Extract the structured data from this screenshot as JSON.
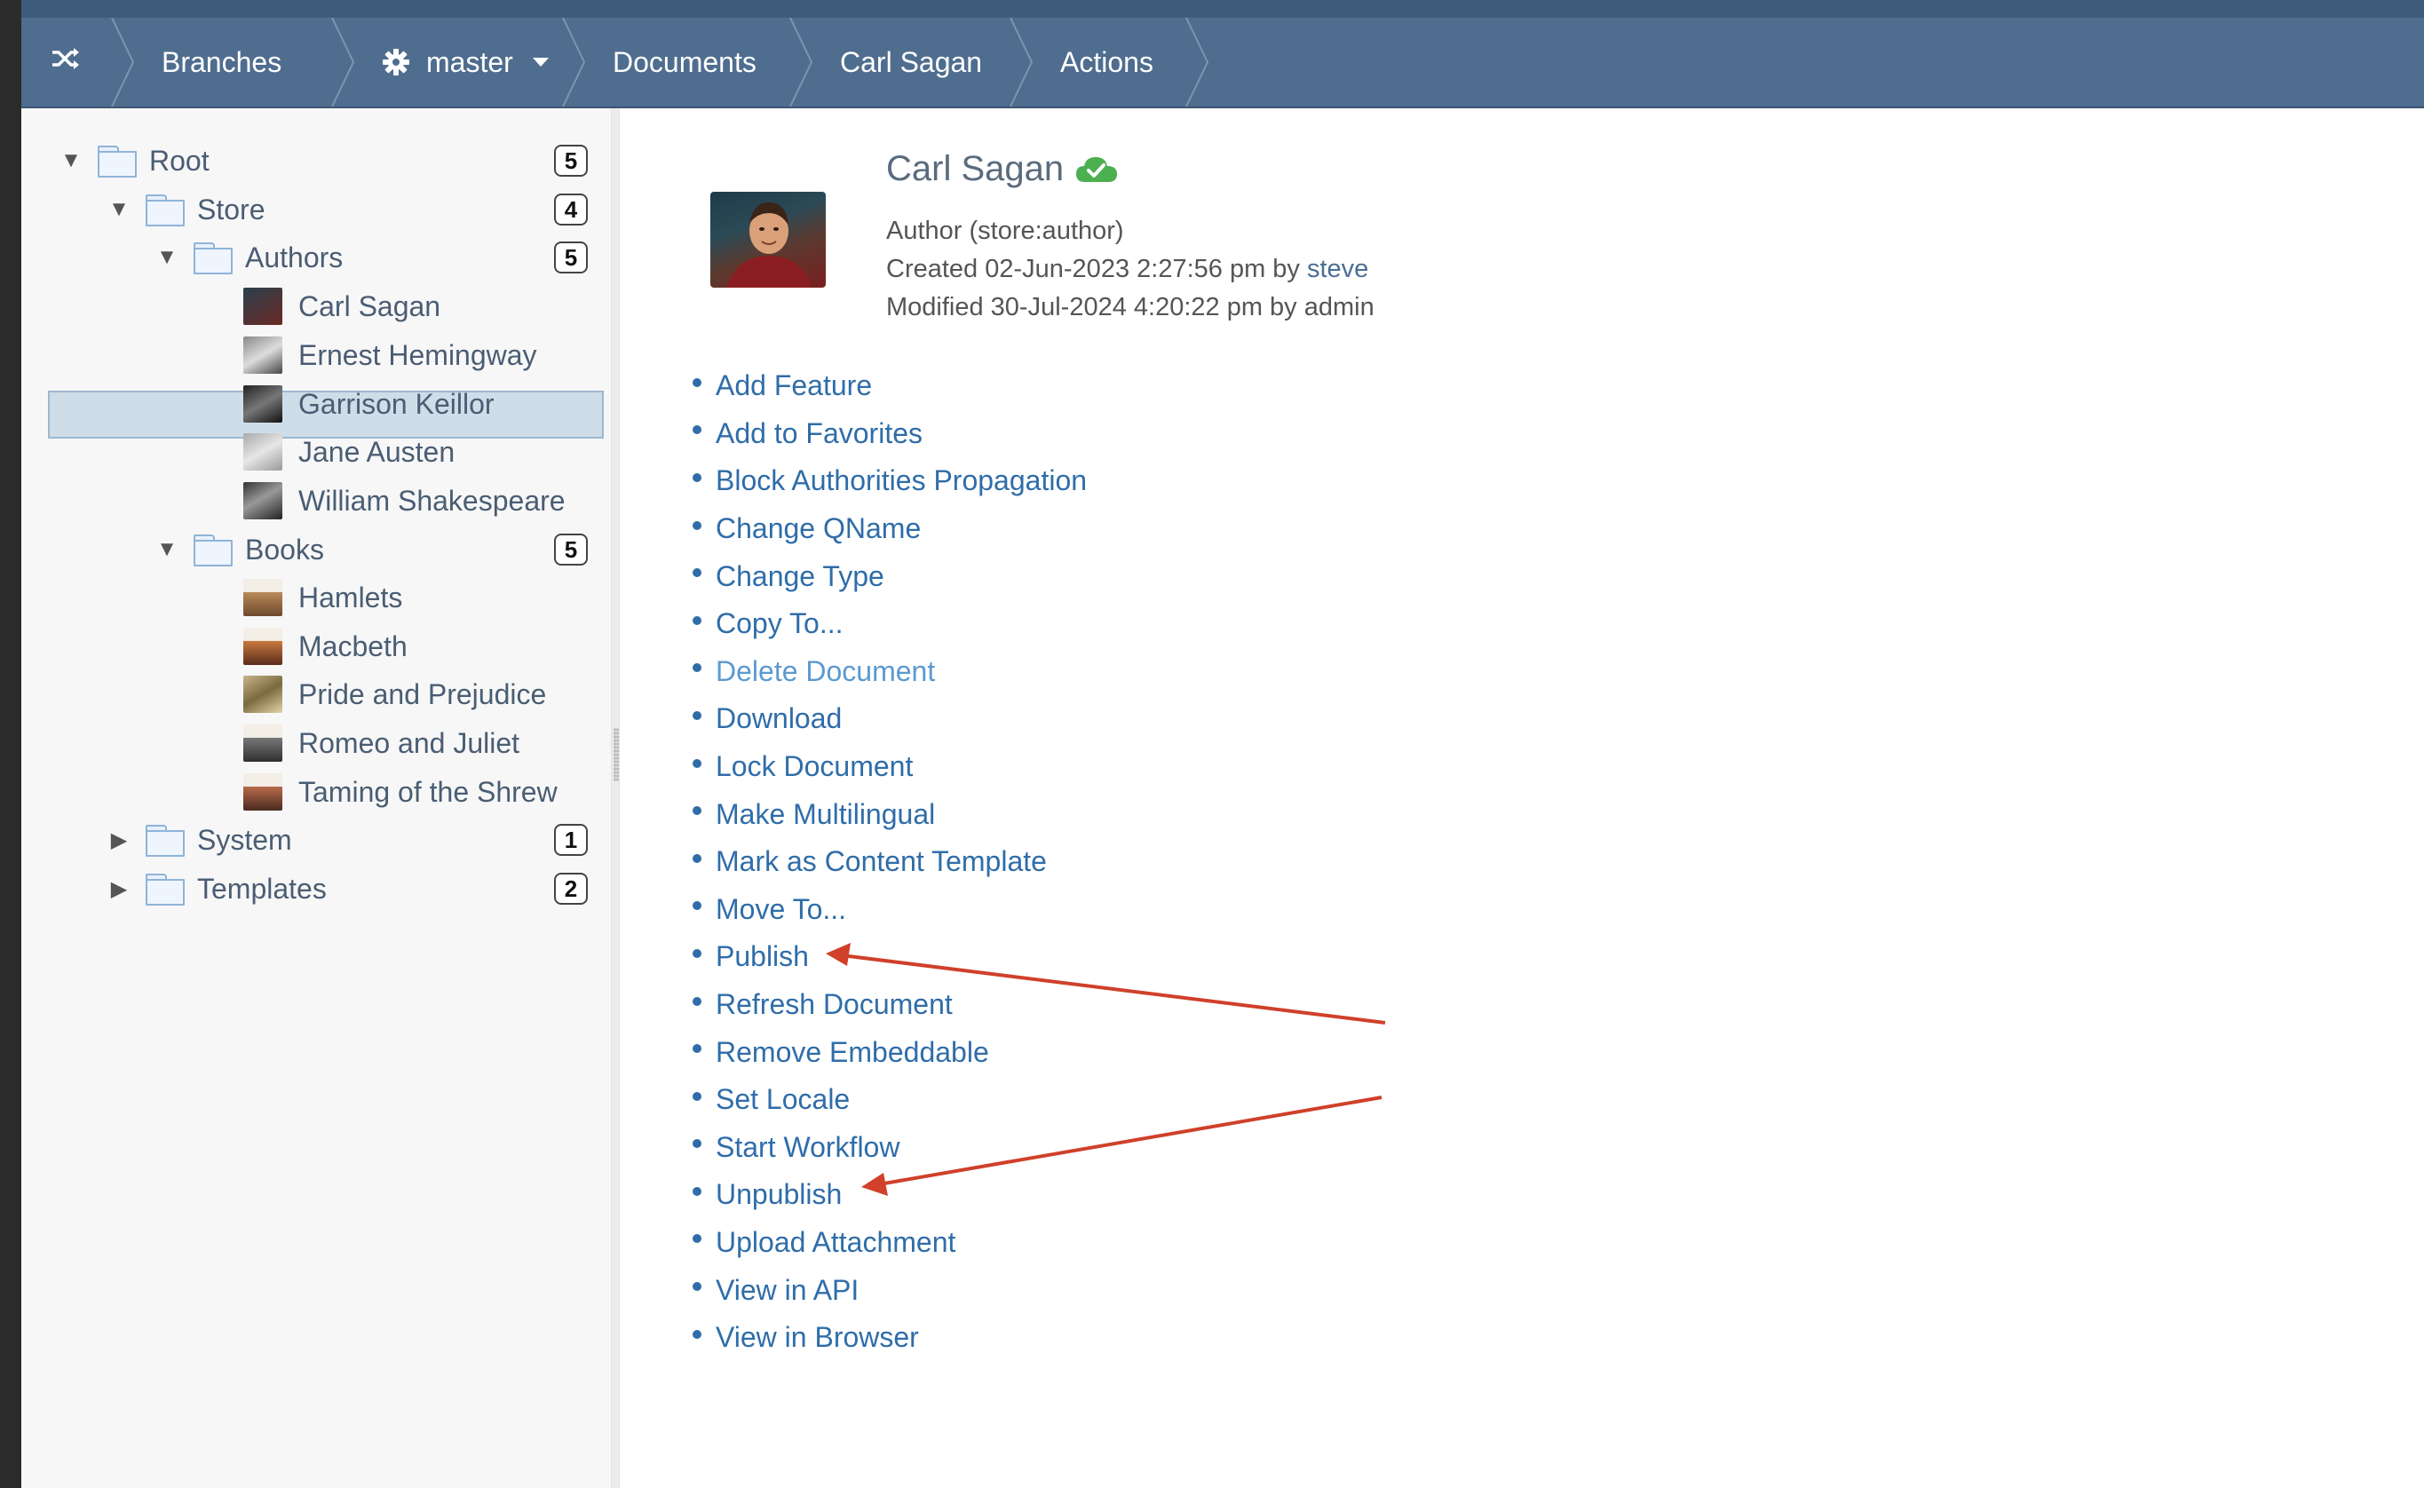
{
  "breadcrumbs": {
    "home_icon": "shuffle-icon",
    "items": [
      {
        "label": "Branches"
      },
      {
        "label": "master",
        "icon": "gear-icon"
      },
      {
        "label": "Documents"
      },
      {
        "label": "Carl Sagan"
      },
      {
        "label": "Actions"
      }
    ]
  },
  "tree": {
    "root": {
      "label": "Root",
      "count": "5"
    },
    "store": {
      "label": "Store",
      "count": "4"
    },
    "authors": {
      "label": "Authors",
      "count": "5"
    },
    "author_items": [
      "Carl Sagan",
      "Ernest Hemingway",
      "Garrison Keillor",
      "Jane Austen",
      "William Shakespeare"
    ],
    "books": {
      "label": "Books",
      "count": "5"
    },
    "book_items": [
      "Hamlets",
      "Macbeth",
      "Pride and Prejudice",
      "Romeo and Juliet",
      "Taming of the Shrew"
    ],
    "system": {
      "label": "System",
      "count": "1"
    },
    "templates": {
      "label": "Templates",
      "count": "2"
    },
    "selected": "Carl Sagan"
  },
  "document": {
    "title": "Carl Sagan",
    "status_icon": "cloud-check-icon",
    "type_line": "Author (store:author)",
    "created_prefix": "Created 02-Jun-2023 2:27:56 pm by",
    "created_by": "steve",
    "modified_line": "Modified 30-Jul-2024 4:20:22 pm by admin"
  },
  "actions": [
    "Add Feature",
    "Add to Favorites",
    "Block Authorities Propagation",
    "Change QName",
    "Change Type",
    "Copy To...",
    "Delete Document",
    "Download",
    "Lock Document",
    "Make Multilingual",
    "Mark as Content Template",
    "Move To...",
    "Publish",
    "Refresh Document",
    "Remove Embeddable",
    "Set Locale",
    "Start Workflow",
    "Unpublish",
    "Upload Attachment",
    "View in API",
    "View in Browser"
  ],
  "colors": {
    "breadcrumb_bg": "#4f6d8f",
    "link": "#2f6da9",
    "annotation_arrow": "#d0402a",
    "status_green": "#4caf50"
  }
}
